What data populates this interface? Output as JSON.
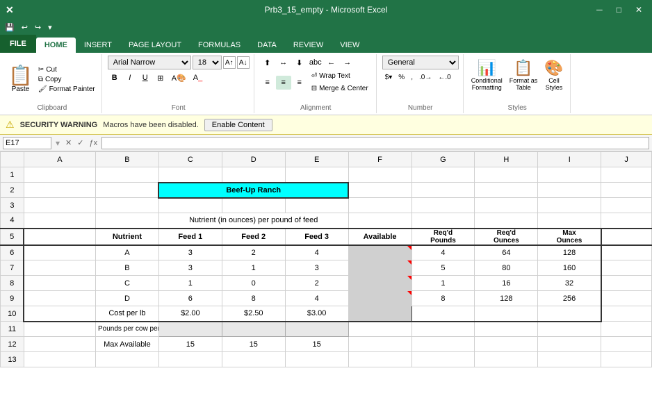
{
  "app": {
    "title": "Prb3_15_empty - Microsoft Excel"
  },
  "quickaccess": {
    "buttons": [
      "💾",
      "↩",
      "↪",
      "▾"
    ]
  },
  "tabs": {
    "file": "FILE",
    "items": [
      "HOME",
      "INSERT",
      "PAGE LAYOUT",
      "FORMULAS",
      "DATA",
      "REVIEW",
      "VIEW"
    ],
    "active": "HOME"
  },
  "ribbon": {
    "clipboard": {
      "label": "Clipboard",
      "paste": "Paste",
      "copy": "Copy",
      "format_painter": "Format Painter"
    },
    "font": {
      "label": "Font",
      "family": "Arial Narrow",
      "size": "18",
      "bold": "B",
      "italic": "I",
      "underline": "U"
    },
    "alignment": {
      "label": "Alignment",
      "wrap_text": "Wrap Text",
      "merge_center": "Merge & Center"
    },
    "number": {
      "label": "Number",
      "format": "General"
    },
    "styles": {
      "label": "Styles",
      "conditional": "Conditional Formatting",
      "format_table": "Format as Table",
      "cell_styles": "Cell Styles"
    }
  },
  "security": {
    "icon": "⚠",
    "label": "SECURITY WARNING",
    "message": "Macros have been disabled.",
    "button": "Enable Content"
  },
  "formula_bar": {
    "cell_ref": "E17",
    "formula": ""
  },
  "columns": {
    "headers": [
      "",
      "A",
      "B",
      "C",
      "D",
      "E",
      "F",
      "G",
      "H",
      "I",
      "J"
    ]
  },
  "rows": [
    {
      "num": "1",
      "cells": [
        "",
        "",
        "",
        "",
        "",
        "",
        "",
        "",
        "",
        ""
      ]
    },
    {
      "num": "2",
      "cells": [
        "",
        "",
        "",
        "Beef-Up Ranch",
        "",
        "",
        "",
        "",
        "",
        ""
      ]
    },
    {
      "num": "3",
      "cells": [
        "",
        "",
        "",
        "",
        "",
        "",
        "",
        "",
        "",
        ""
      ]
    },
    {
      "num": "4",
      "cells": [
        "",
        "",
        "",
        "Nutrient (in ounces) per pound of feed",
        "",
        "",
        "",
        "",
        "",
        ""
      ]
    },
    {
      "num": "5",
      "cells": [
        "",
        "Nutrient",
        "Feed 1",
        "Feed 2",
        "Feed 3",
        "Available",
        "Req'd Pounds",
        "Req'd Ounces",
        "Max Ounces",
        ""
      ]
    },
    {
      "num": "6",
      "cells": [
        "",
        "A",
        "3",
        "2",
        "4",
        "",
        "4",
        "64",
        "128",
        ""
      ]
    },
    {
      "num": "7",
      "cells": [
        "",
        "B",
        "3",
        "1",
        "3",
        "",
        "5",
        "80",
        "160",
        ""
      ]
    },
    {
      "num": "8",
      "cells": [
        "",
        "C",
        "1",
        "0",
        "2",
        "",
        "1",
        "16",
        "32",
        ""
      ]
    },
    {
      "num": "9",
      "cells": [
        "",
        "D",
        "6",
        "8",
        "4",
        "",
        "8",
        "128",
        "256",
        ""
      ]
    },
    {
      "num": "10",
      "cells": [
        "",
        "Cost per lb",
        "$2.00",
        "$2.50",
        "$3.00",
        "",
        "",
        "",
        "",
        ""
      ]
    },
    {
      "num": "11",
      "cells": [
        "",
        "Pounds per cow per mo",
        "",
        "",
        "",
        "",
        "",
        "",
        "",
        ""
      ]
    },
    {
      "num": "12",
      "cells": [
        "",
        "Max Available",
        "15",
        "15",
        "15",
        "",
        "",
        "",
        "",
        ""
      ]
    }
  ]
}
